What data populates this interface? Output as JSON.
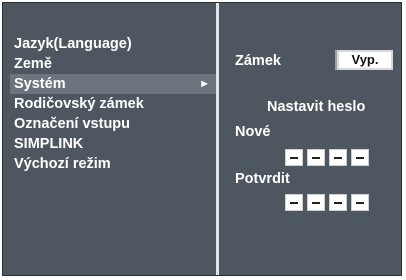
{
  "menu": {
    "items": [
      {
        "label": "Jazyk(Language)",
        "selected": false
      },
      {
        "label": "Země",
        "selected": false
      },
      {
        "label": "Systém",
        "selected": true
      },
      {
        "label": "Rodičovský zámek",
        "selected": false
      },
      {
        "label": "Označení vstupu",
        "selected": false
      },
      {
        "label": "SIMPLINK",
        "selected": false
      },
      {
        "label": "Výchozí režim",
        "selected": false
      }
    ],
    "selected_arrow": "►"
  },
  "lock": {
    "label": "Zámek",
    "value": "Vyp."
  },
  "password": {
    "heading": "Nastavit heslo",
    "new_label": "Nové",
    "confirm_label": "Potvrdit",
    "new_digits": [
      "-",
      "-",
      "-",
      "-"
    ],
    "confirm_digits": [
      "-",
      "-",
      "-",
      "-"
    ]
  },
  "colors": {
    "panel_bg": "#4e5760",
    "selected_bg": "#6c757e",
    "text": "#ffffff"
  }
}
